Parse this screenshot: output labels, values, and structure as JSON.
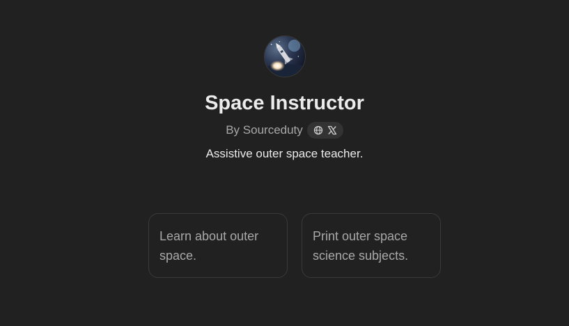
{
  "gpt": {
    "name": "Space Instructor",
    "byline": "By Sourceduty",
    "description": "Assistive outer space teacher.",
    "avatar_icon": "rocket-launch-avatar"
  },
  "social_links": [
    {
      "icon": "globe-icon"
    },
    {
      "icon": "x-logo-icon"
    }
  ],
  "conversation_starters": [
    {
      "label": "Learn about outer space."
    },
    {
      "label": "Print outer space science subjects."
    }
  ],
  "colors": {
    "background": "#212121",
    "title": "#ececec",
    "muted_text": "#a9a9a9",
    "card_border": "#3a3a3a",
    "pill_background": "#333333"
  }
}
